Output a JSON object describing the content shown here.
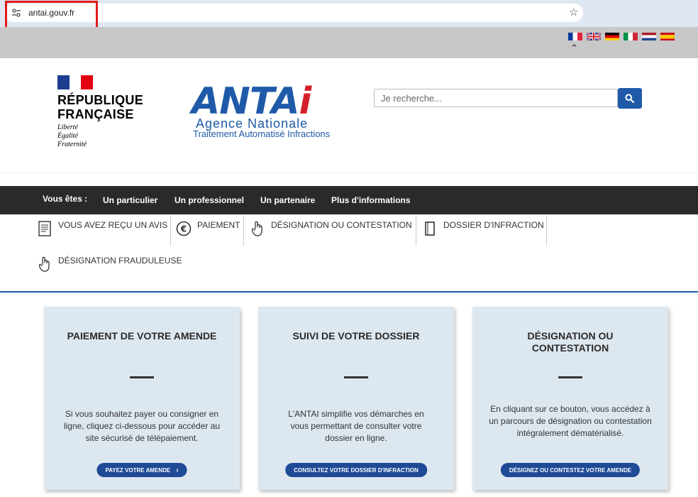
{
  "browser": {
    "url": "antai.gouv.fr"
  },
  "languages": [
    "Français",
    "English",
    "Deutsch",
    "Italiano",
    "Nederlands",
    "Español"
  ],
  "republique": {
    "title_line1": "RÉPUBLIQUE",
    "title_line2": "FRANÇAISE",
    "motto1": "Liberté",
    "motto2": "Égalité",
    "motto3": "Fraternité"
  },
  "antai_logo": {
    "word_prefix": "ANTA",
    "word_i": "i",
    "subtitle1": "Agence Nationale",
    "subtitle2": "Traitement Automatisé Infractions"
  },
  "search": {
    "placeholder": "Je recherche..."
  },
  "main_nav": {
    "label": "Vous êtes :",
    "items": [
      "Un particulier",
      "Un professionnel",
      "Un partenaire",
      "Plus d'informations"
    ]
  },
  "sub_nav": {
    "items": [
      "VOUS AVEZ REÇU UN AVIS",
      "PAIEMENT",
      "DÉSIGNATION OU CONTESTATION",
      "DOSSIER D'INFRACTION",
      "DÉSIGNATION FRAUDULEUSE"
    ]
  },
  "cards": [
    {
      "title": "PAIEMENT DE VOTRE AMENDE",
      "text": "Si vous souhaitez payer ou consigner en ligne, cliquez ci-dessous pour accéder au site sécurisé de télépaiement.",
      "button": "PAYEZ VOTRE AMENDE"
    },
    {
      "title": "SUIVI DE VOTRE DOSSIER",
      "text": "L'ANTAI simplifie vos démarches en vous permettant de consulter votre dossier en ligne.",
      "button": "CONSULTEZ VOTRE DOSSIER D'INFRACTION"
    },
    {
      "title": "DÉSIGNATION OU CONTESTATION",
      "text": "En cliquant sur ce bouton, vous accédez à un parcours de désignation ou contestation intégralement dématérialisé.",
      "button": "DÉSIGNEZ OU CONTESTEZ VOTRE AMENDE"
    }
  ],
  "colors": {
    "primary_blue": "#1e5aa8",
    "button_blue": "#1e4a96",
    "nav_dark": "#2a2a2a",
    "card_bg": "#dde7ef",
    "highlight_red": "#e01b1b"
  }
}
